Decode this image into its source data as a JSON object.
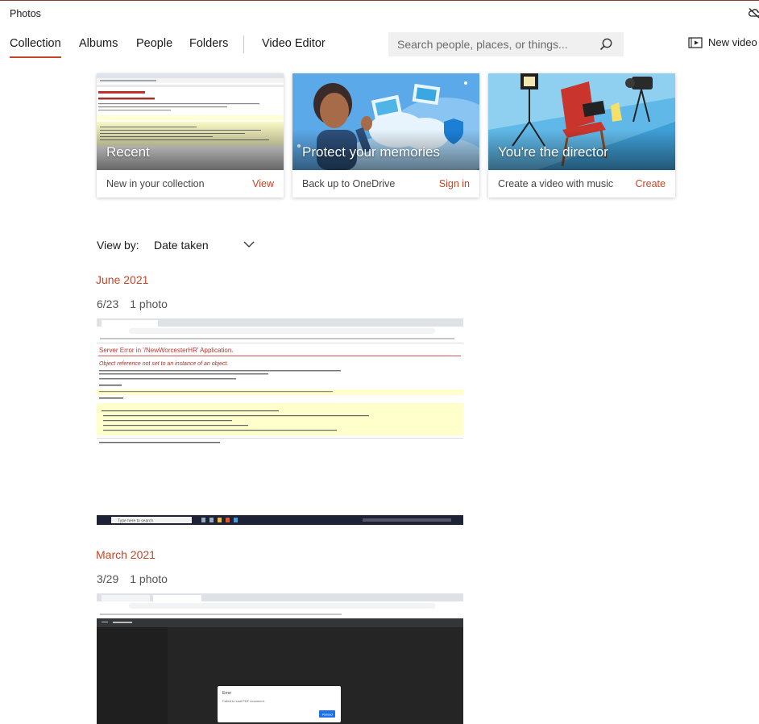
{
  "app": {
    "title": "Photos"
  },
  "nav": {
    "tabs": [
      {
        "label": "Collection",
        "active": true
      },
      {
        "label": "Albums",
        "active": false
      },
      {
        "label": "People",
        "active": false
      },
      {
        "label": "Folders",
        "active": false
      },
      {
        "label": "Video Editor",
        "active": false
      }
    ],
    "search_placeholder": "Search people, places, or things...",
    "new_video_label": "New video"
  },
  "cards": [
    {
      "title": "Recent",
      "caption": "New in your collection",
      "action": "View"
    },
    {
      "title": "Protect your memories",
      "caption": "Back up to OneDrive",
      "action": "Sign in"
    },
    {
      "title": "You're the director",
      "caption": "Create a video with music",
      "action": "Create"
    }
  ],
  "view_by": {
    "label": "View by:",
    "value": "Date taken"
  },
  "groups": [
    {
      "month": "June 2021",
      "day": "6/23",
      "count": "1 photo"
    },
    {
      "month": "March 2021",
      "day": "3/29",
      "count": "1 photo"
    }
  ],
  "screenshot_text": {
    "june_heading": "Server Error in '/NewWorcesterHR' Application.",
    "june_subheading": "Object reference not set to an instance of an object.",
    "june_taskbar_search": "Type here to search",
    "march_dialog_title": "Error",
    "march_dialog_body": "Failed to load PDF document.",
    "march_dialog_button": "Reload"
  },
  "colors": {
    "accent": "#c4462a",
    "search_bg": "#f0f0f0",
    "text": "#1a1a1a"
  },
  "icons": [
    "cloud-off-icon",
    "search-icon",
    "new-video-icon",
    "chevron-down-icon"
  ]
}
